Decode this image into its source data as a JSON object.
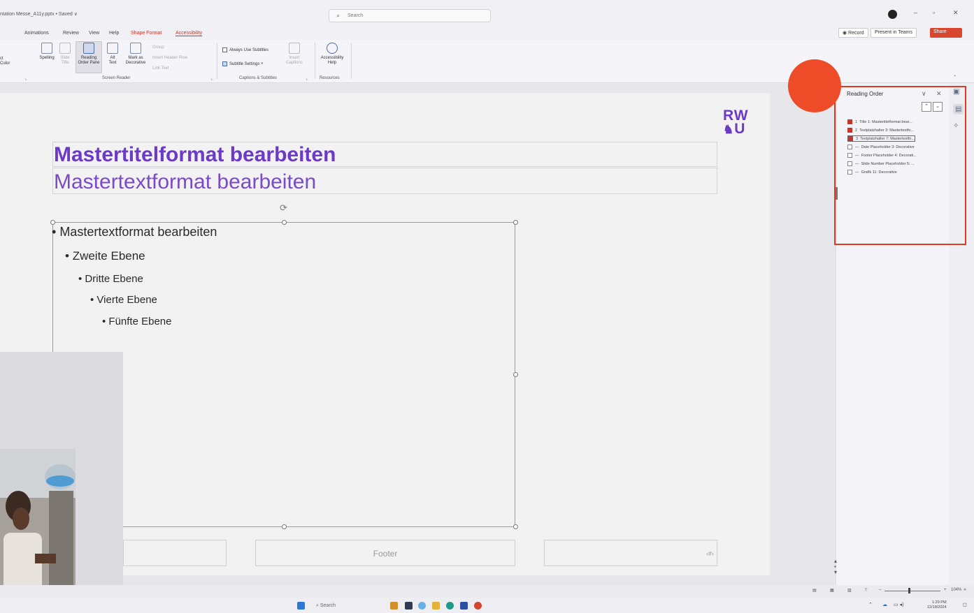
{
  "titlebar": {
    "doc_title": "ntation Messe_A11y.pptx • Saved ∨",
    "search_placeholder": "Search",
    "min": "–",
    "max": "▫",
    "close": "✕"
  },
  "tabs": [
    "Animations",
    "Review",
    "View",
    "Help",
    "Shape Format",
    "Accessibility"
  ],
  "right_buttons": {
    "record": "◉ Record",
    "present": "Present in Teams",
    "share": "Share"
  },
  "ribbon": {
    "items": {
      "select_color": "ct\nColor",
      "spelling": "Spelling",
      "slide_title": "Slide\nTitle",
      "reading_order": "Reading\nOrder Pane",
      "alt_text": "Alt\nText",
      "mark_decorative": "Mark as\nDecorative",
      "group": "Group",
      "insert_header_row": "Insert Header Row",
      "link_text": "Link Text",
      "always_subtitles": "Always Use Subtitles",
      "subtitle_settings": "Subtitle Settings",
      "insert_captions": "Insert\nCaptions",
      "accessibility_help": "Accessibility\nHelp"
    },
    "groups": {
      "screen_reader": "Screen Reader",
      "captions": "Captions & Subtitles",
      "resources": "Resources"
    }
  },
  "slide": {
    "logo_top": "RW",
    "logo_bottom": "U",
    "title": "Mastertitelformat bearbeiten",
    "subtitle": "Mastertextformat bearbeiten",
    "bullets": [
      "Mastertextformat bearbeiten",
      "Zweite Ebene",
      "Dritte Ebene",
      "Vierte Ebene",
      "Fünfte Ebene"
    ],
    "footer": "Footer",
    "slide_number": "‹#›"
  },
  "reading_order": {
    "title": "Reading Order",
    "items": [
      {
        "num": "1",
        "label": "Title 1: Mastertitelformat bear...",
        "checked": true
      },
      {
        "num": "2",
        "label": "Textplatzhalter 3: Mastertextfo...",
        "checked": true
      },
      {
        "num": "3",
        "label": "Textplatzhalter 7: Mastertextfo...",
        "checked": true
      },
      {
        "num": "—",
        "label": "Date Placeholder 3: Decorative",
        "checked": false
      },
      {
        "num": "—",
        "label": "Footer Placeholder 4: Decorati...",
        "checked": false
      },
      {
        "num": "—",
        "label": "Slide Number Placeholder 5: ...",
        "checked": false
      },
      {
        "num": "—",
        "label": "Grafik 11: Decorative",
        "checked": false
      }
    ]
  },
  "statusbar": {
    "zoom": "104%"
  },
  "taskbar": {
    "search": "Search",
    "time": "1:29 PM",
    "date": "12/18/2024"
  },
  "colors": {
    "accent_purple": "#6c3ac6",
    "highlight_red": "#e03a21",
    "share_red": "#d9462f"
  }
}
